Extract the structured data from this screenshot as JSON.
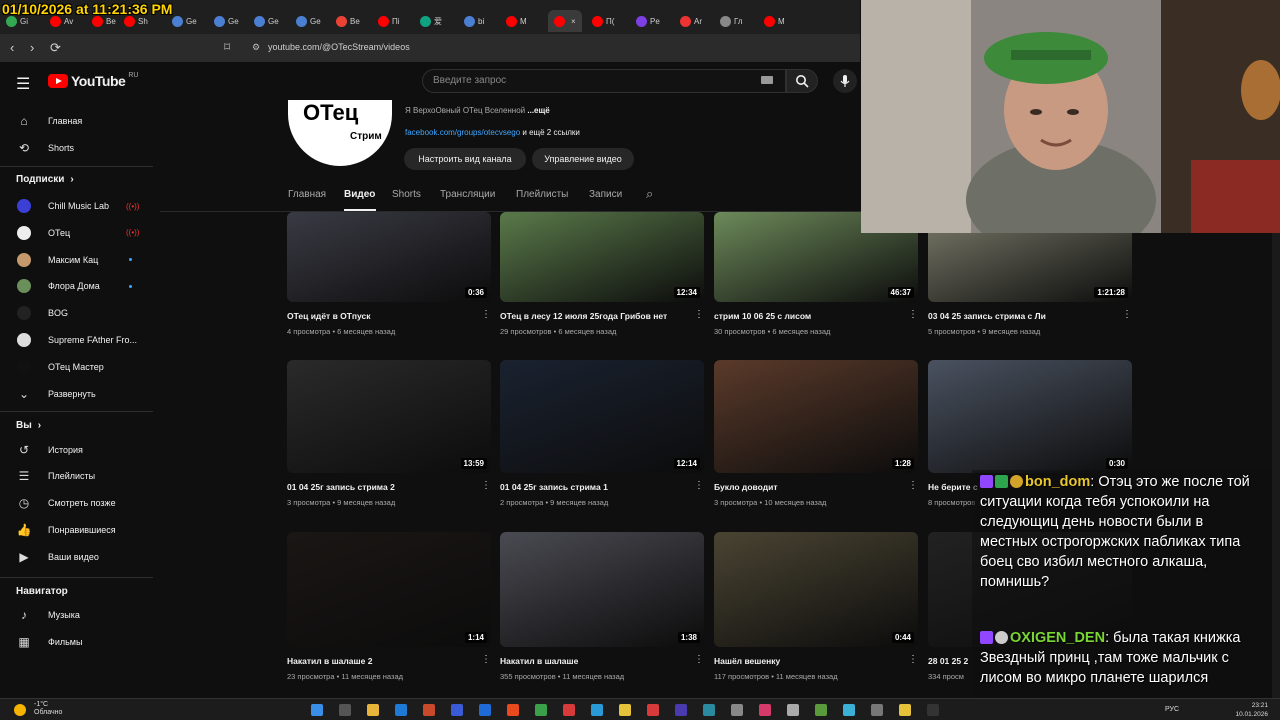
{
  "overlay": {
    "timestamp": "01/10/2026 at 11:21:36 PM"
  },
  "browser": {
    "tabs": [
      {
        "label": "Gi",
        "color": "#33a852"
      },
      {
        "label": "Av",
        "color": "#ff0000"
      },
      {
        "label": "Be",
        "color": "#ff0000"
      },
      {
        "label": "Sh",
        "color": "#ff0000"
      },
      {
        "label": "Ge",
        "color": "#4a7fd1"
      },
      {
        "label": "Ge",
        "color": "#4a7fd1"
      },
      {
        "label": "Ge",
        "color": "#4a7fd1"
      },
      {
        "label": "Ge",
        "color": "#4a7fd1"
      },
      {
        "label": "Be",
        "color": "#ea4335"
      },
      {
        "label": "Пi",
        "color": "#ff0000"
      },
      {
        "label": "爱",
        "color": "#10a37f"
      },
      {
        "label": "bi",
        "color": "#4a7fd1"
      },
      {
        "label": "M",
        "color": "#ff0000"
      },
      {
        "label": "",
        "color": "#ff0000",
        "active": true,
        "close": "×"
      },
      {
        "label": "П(",
        "color": "#ff0000"
      },
      {
        "label": "Pe",
        "color": "#7b3fe4"
      },
      {
        "label": "Ar",
        "color": "#e33"
      },
      {
        "label": "Гл",
        "color": "#888"
      },
      {
        "label": "M",
        "color": "#ff0000"
      }
    ],
    "url": "youtube.com/@OTecStream/videos",
    "back": "‹",
    "forward": "›",
    "reload": "⟳"
  },
  "header": {
    "logo_text": "YouTube",
    "logo_region": "RU",
    "search_placeholder": "Введите запрос",
    "search_icon": "search-icon",
    "mic_icon": "mic-icon"
  },
  "sidebar": {
    "main": [
      {
        "label": "Главная",
        "icon": "⌂"
      },
      {
        "label": "Shorts",
        "icon": "⟲"
      }
    ],
    "subs_title": "Подписки",
    "subs": [
      {
        "label": "Chill Music Lab",
        "color": "#3b3fd6",
        "status": "live"
      },
      {
        "label": "ОТец",
        "color": "#eeeeee",
        "status": "live"
      },
      {
        "label": "Максим Кац",
        "color": "#c49a6c",
        "status": "dot"
      },
      {
        "label": "Флора Дома",
        "color": "#6b8f5a",
        "status": "dot"
      },
      {
        "label": "BOG",
        "color": "#222222",
        "status": ""
      },
      {
        "label": "Supreme FAther Fro...",
        "color": "#dddddd",
        "status": ""
      },
      {
        "label": "ОТец Мастер",
        "color": "#111111",
        "status": ""
      }
    ],
    "expand_label": "Развернуть",
    "live_mark": "((•))",
    "you_title": "Вы",
    "you": [
      {
        "label": "История",
        "icon": "↺"
      },
      {
        "label": "Плейлисты",
        "icon": "☰"
      },
      {
        "label": "Смотреть позже",
        "icon": "◷"
      },
      {
        "label": "Понравившиеся",
        "icon": "👍"
      },
      {
        "label": "Ваши видео",
        "icon": "▶"
      }
    ],
    "nav_title": "Навигатор",
    "nav": [
      {
        "label": "Музыка",
        "icon": "♪"
      },
      {
        "label": "Фильмы",
        "icon": "▦"
      }
    ]
  },
  "channel": {
    "avatar_line1": "ОТец",
    "avatar_line2": "Стрим",
    "description": "Я ВерхоОвный ОТец Вселенной",
    "more": "...ещё",
    "link": "facebook.com/groups/otecvsego",
    "link_more": " и ещё 2 ссылки",
    "customize_btn": "Настроить вид канала",
    "manage_btn": "Управление видео",
    "tabs": [
      "Главная",
      "Видео",
      "Shorts",
      "Трансляции",
      "Плейлисты",
      "Записи"
    ],
    "active_tab": "Видео"
  },
  "videos": [
    {
      "title": "ОТец идёт в ОТпуск",
      "views": "4 просмотра",
      "age": "6 месяцев назад",
      "duration": "0:36",
      "bg": "#3a3a44"
    },
    {
      "title": "ОТец в лесу 12 июля 25года Грибов нет",
      "views": "29 просмотров",
      "age": "6 месяцев назад",
      "duration": "12:34",
      "bg": "#5a7a4a"
    },
    {
      "title": "стрим 10 06 25 с лисом",
      "views": "30 просмотров",
      "age": "6 месяцев назад",
      "duration": "46:37",
      "bg": "#6d8a5a"
    },
    {
      "title": "03 04 25 запись стрима с Ли",
      "views": "5 просмотров",
      "age": "9 месяцев назад",
      "duration": "1:21:28",
      "bg": "#7a7a6a"
    },
    {
      "title": "01 04 25г запись стрима 2",
      "views": "3 просмотра",
      "age": "9 месяцев назад",
      "duration": "13:59",
      "bg": "#2a2a2a"
    },
    {
      "title": "01 04 25г запись стрима 1",
      "views": "2 просмотра",
      "age": "9 месяцев назад",
      "duration": "12:14",
      "bg": "#1a2230"
    },
    {
      "title": "Букло доводит",
      "views": "3 просмотра",
      "age": "10 месяцев назад",
      "duration": "1:28",
      "bg": "#5a3a2a"
    },
    {
      "title": "Не берите с",
      "views": "8 просмотров",
      "age": "",
      "duration": "0:30",
      "bg": "#4a5260"
    },
    {
      "title": "Накатил в шалаше 2",
      "views": "23 просмотра",
      "age": "11 месяцев назад",
      "duration": "1:14",
      "bg": "#1a1614"
    },
    {
      "title": "Накатил в шалаше",
      "views": "355 просмотров",
      "age": "11 месяцев назад",
      "duration": "1:38",
      "bg": "#4a4a52"
    },
    {
      "title": "Нашёл вешенку",
      "views": "117 просмотров",
      "age": "11 месяцев назад",
      "duration": "0:44",
      "bg": "#4a4432"
    },
    {
      "title": "28 01 25 2",
      "views": "334 просм",
      "age": "",
      "duration": "",
      "bg": "#222222"
    }
  ],
  "chat": [
    {
      "user": "bon_dom",
      "user_color": "#e8c62e",
      "text": "Отэц это же после той ситуации когда тебя успокоили на следующиц день новости были в местных острогоржских пабликах типа боец сво избил местного алкаша, помнишь?"
    },
    {
      "user": "OXIGEN_DEN",
      "user_color": "#7ad633",
      "text": "была такая книжка Звездный принц ,там тоже мальчик с лисом во микро планете шарился"
    }
  ],
  "taskbar": {
    "weather_temp": "-1°C",
    "weather_desc": "Облачно",
    "lang": "РУС",
    "time": "23:21",
    "date": "10.01.2026"
  }
}
